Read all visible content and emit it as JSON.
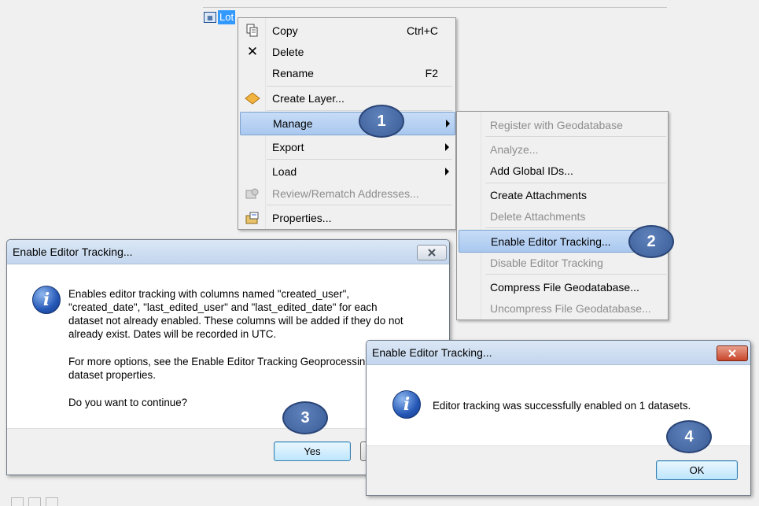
{
  "tree": {
    "layer_label": "Lot"
  },
  "context_menu": {
    "items": [
      {
        "label": "Copy",
        "shortcut": "Ctrl+C",
        "icon": "copy-icon"
      },
      {
        "label": "Delete",
        "shortcut": "",
        "icon": "delete-x-icon"
      },
      {
        "label": "Rename",
        "shortcut": "F2",
        "icon": ""
      },
      {
        "label": "Create Layer...",
        "shortcut": "",
        "icon": "create-layer-diamond-icon"
      },
      {
        "label": "Manage",
        "submenu": true,
        "highlighted": true
      },
      {
        "label": "Export",
        "submenu": true
      },
      {
        "label": "Load",
        "submenu": true
      },
      {
        "label": "Review/Rematch Addresses...",
        "disabled": true,
        "icon": "review-addresses-icon"
      },
      {
        "label": "Properties...",
        "icon": "properties-icon"
      }
    ]
  },
  "submenu": {
    "items": [
      {
        "label": "Register with Geodatabase",
        "disabled": true
      },
      {
        "label": "Analyze...",
        "disabled": true
      },
      {
        "label": "Add Global IDs..."
      },
      {
        "label": "Create Attachments"
      },
      {
        "label": "Delete Attachments",
        "disabled": true
      },
      {
        "label": "Enable Editor Tracking...",
        "highlighted": true
      },
      {
        "label": "Disable Editor Tracking",
        "disabled": true
      },
      {
        "label": "Compress File Geodatabase..."
      },
      {
        "label": "Uncompress File Geodatabase...",
        "disabled": true
      }
    ]
  },
  "dialog1": {
    "title": "Enable Editor Tracking...",
    "lines": [
      "Enables editor tracking with columns named \"created_user\",",
      "\"created_date\", \"last_edited_user\" and \"last_edited_date\" for each",
      "dataset not already enabled. These columns will be added if they do not",
      "already exist. Dates will be recorded in UTC.",
      "For more options, see the Enable Editor Tracking Geoprocessing tool or",
      "dataset properties.",
      "Do you want to continue?"
    ],
    "yes_label": "Yes"
  },
  "dialog2": {
    "title": "Enable Editor Tracking...",
    "message": "Editor tracking was successfully enabled on 1 datasets.",
    "ok_label": "OK"
  },
  "steps": [
    "1",
    "2",
    "3",
    "4"
  ],
  "colors": {
    "badge": "#3f62a0",
    "highlight": "#b9d2f2",
    "titlebar": "#cddcef",
    "close_red": "#c8452a"
  }
}
